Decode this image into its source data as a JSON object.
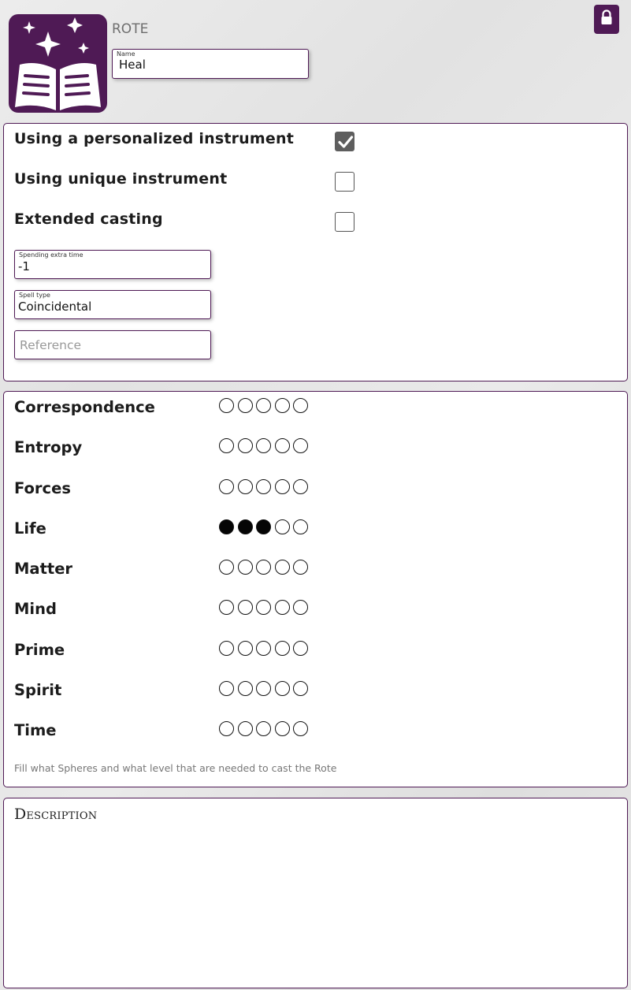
{
  "header": {
    "title": "ROTE",
    "logo_icon": "spellbook-icon",
    "lock_icon": "lock-icon",
    "accent_color": "#4f1a55"
  },
  "name_field": {
    "label": "Name",
    "value": "Heal"
  },
  "options": [
    {
      "label": "Using a personalized instrument",
      "checked": true
    },
    {
      "label": "Using unique instrument",
      "checked": false
    },
    {
      "label": "Extended casting",
      "checked": false
    }
  ],
  "extra_time_field": {
    "label": "Spending extra time",
    "value": "-1"
  },
  "spell_type_field": {
    "label": "Spell type",
    "value": "Coincidental"
  },
  "reference_field": {
    "placeholder": "Reference"
  },
  "spheres": [
    {
      "name": "Correspondence",
      "level": 0,
      "max": 5
    },
    {
      "name": "Entropy",
      "level": 0,
      "max": 5
    },
    {
      "name": "Forces",
      "level": 0,
      "max": 5
    },
    {
      "name": "Life",
      "level": 3,
      "max": 5
    },
    {
      "name": "Matter",
      "level": 0,
      "max": 5
    },
    {
      "name": "Mind",
      "level": 0,
      "max": 5
    },
    {
      "name": "Prime",
      "level": 0,
      "max": 5
    },
    {
      "name": "Spirit",
      "level": 0,
      "max": 5
    },
    {
      "name": "Time",
      "level": 0,
      "max": 5
    }
  ],
  "spheres_hint": "Fill what Spheres and what level that are needed to cast the Rote",
  "description": {
    "title": "Description"
  }
}
